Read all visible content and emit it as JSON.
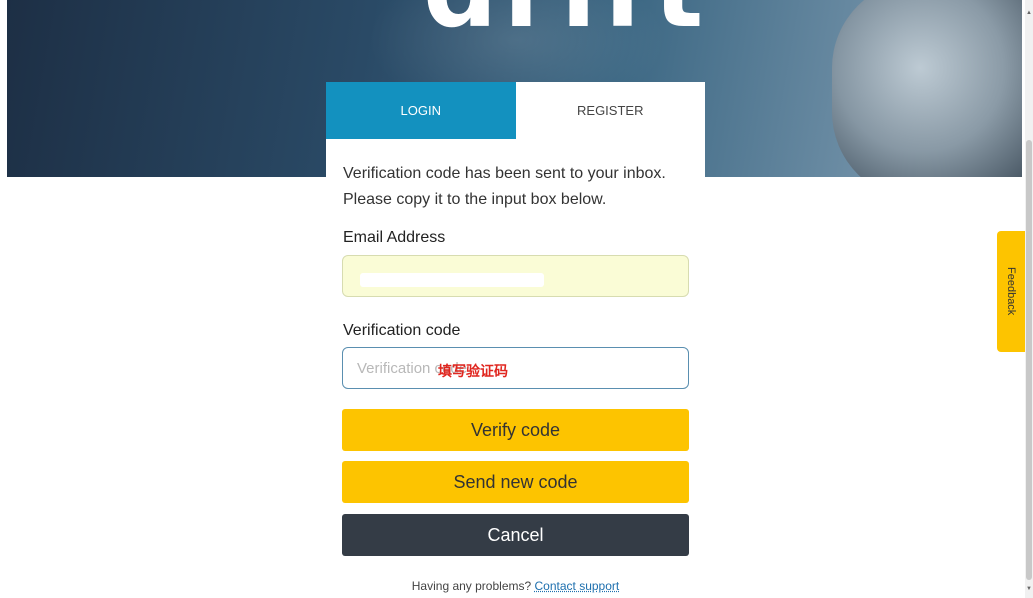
{
  "hero": {
    "logo_text": "drift"
  },
  "tabs": [
    {
      "label": "LOGIN",
      "active": true
    },
    {
      "label": "REGISTER",
      "active": false
    }
  ],
  "message": {
    "line1": "Verification code has been sent to your inbox.",
    "line2": "Please copy it to the input box below."
  },
  "email": {
    "label": "Email Address",
    "value": ""
  },
  "verification": {
    "label": "Verification code",
    "placeholder": "Verification code",
    "annotation": "填写验证码"
  },
  "buttons": {
    "verify": "Verify code",
    "resend": "Send new code",
    "cancel": "Cancel"
  },
  "help": {
    "text": "Having any problems?",
    "link": "Contact support"
  },
  "feedback_tab": "Feedback",
  "colors": {
    "tab_active": "#1391bf",
    "primary_button": "#fdc400",
    "cancel_button": "#343c46",
    "email_field_bg": "#fafcd6",
    "annotation": "#e0261f"
  }
}
